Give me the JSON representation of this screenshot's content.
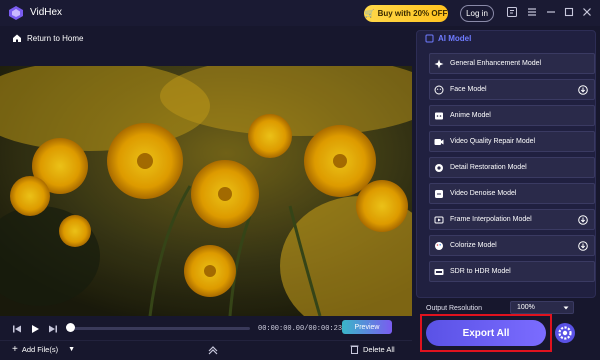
{
  "app": {
    "name": "VidHex",
    "promo_label": "Buy with 20% OFF",
    "login_label": "Log in"
  },
  "nav": {
    "back_label": "Return to Home"
  },
  "player": {
    "timecode": "00:00:00.00/00:00:23.18",
    "preview_label": "Preview",
    "progress": 0
  },
  "footer": {
    "add_files_label": "Add File(s)",
    "delete_all_label": "Delete All"
  },
  "panel": {
    "section_title": "AI Model",
    "models": [
      {
        "label": "General Enhancement Model",
        "icon": "sparkle-icon",
        "download": false
      },
      {
        "label": "Face Model",
        "icon": "face-icon",
        "download": true
      },
      {
        "label": "Anime Model",
        "icon": "anime-icon",
        "download": false
      },
      {
        "label": "Video Quality Repair Model",
        "icon": "video-repair-icon",
        "download": false
      },
      {
        "label": "Detail Restoration Model",
        "icon": "detail-icon",
        "download": false
      },
      {
        "label": "Video Denoise Model",
        "icon": "denoise-icon",
        "download": false
      },
      {
        "label": "Frame Interpolation Model",
        "icon": "frame-icon",
        "download": true
      },
      {
        "label": "Colorize Model",
        "icon": "palette-icon",
        "download": true
      },
      {
        "label": "SDR to HDR Model",
        "icon": "hdr-icon",
        "download": false
      }
    ],
    "output_resolution_label": "Output Resolution",
    "output_resolution_value": "100%",
    "export_label": "Export All"
  },
  "colors": {
    "accent": "#6a5cf5",
    "promo": "#ffcc2e",
    "highlight": "#e0121e"
  }
}
